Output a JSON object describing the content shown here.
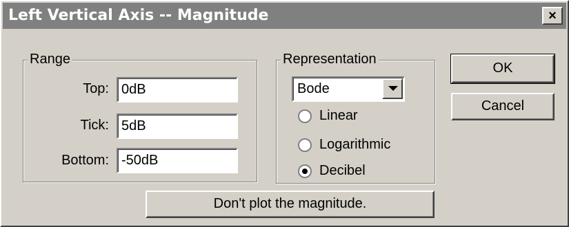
{
  "window": {
    "title": "Left Vertical Axis -- Magnitude",
    "close_glyph": "×"
  },
  "range": {
    "legend": "Range",
    "top_label": "Top:",
    "top_value": "0dB",
    "tick_label": "Tick:",
    "tick_value": "5dB",
    "bottom_label": "Bottom:",
    "bottom_value": "-50dB"
  },
  "representation": {
    "legend": "Representation",
    "selected_option": "Bode",
    "radios": [
      {
        "label": "Linear",
        "checked": false
      },
      {
        "label": "Logarithmic",
        "checked": false
      },
      {
        "label": "Decibel",
        "checked": true
      }
    ]
  },
  "buttons": {
    "ok": "OK",
    "cancel": "Cancel",
    "dont_plot": "Don't plot the magnitude."
  }
}
